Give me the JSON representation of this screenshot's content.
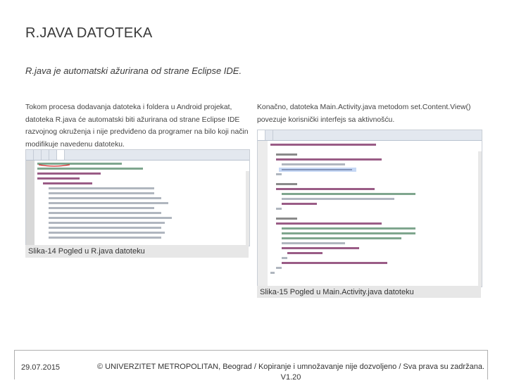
{
  "slide": {
    "title": "R.JAVA DATOTEKA",
    "subtitle": "R.java je automatski ažurirana od strane Eclipse IDE.",
    "left_paragraph": "Tokom procesa dodavanja datoteka i foldera u Android projekat, datoteka R.java će automatski biti ažurirana od strane Eclipse IDE razvojnog okruženja i nije predviđeno da programer na bilo koji način modifikuje navedenu datoteku.",
    "right_paragraph": "Konačno, datoteka Main.Activity.java metodom set.Content.View() povezuje korisnički interfejs sa aktivnošću.",
    "caption_left": "Slika-14 Pogled u R.java datoteku",
    "caption_right": "Slika-15 Pogled u Main.Activity.java datoteku"
  },
  "footer": {
    "date": "29.07.2015",
    "copyright": "© UNIVERZITET METROPOLITAN, Beograd / Kopiranje i umnožavanje nije dozvoljeno / Sva prava su zadržana. V1.20"
  }
}
